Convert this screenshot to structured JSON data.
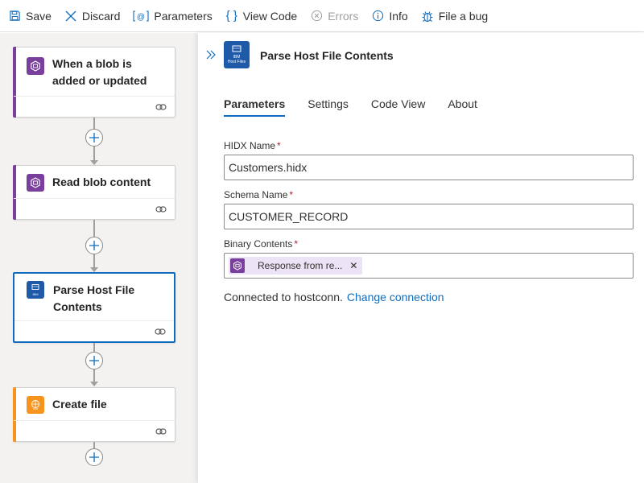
{
  "toolbar": {
    "save": "Save",
    "discard": "Discard",
    "parameters": "Parameters",
    "view_code": "View Code",
    "errors": "Errors",
    "info": "Info",
    "file_bug": "File a bug"
  },
  "canvas": {
    "cards": [
      {
        "title": "When a blob is added or updated",
        "accent": "#7a3e9d"
      },
      {
        "title": "Read blob content",
        "accent": "#7a3e9d"
      },
      {
        "title": "Parse Host File Contents",
        "accent": "#1e5aa8"
      },
      {
        "title": "Create file",
        "accent": "#f7941d"
      }
    ]
  },
  "panel": {
    "title": "Parse Host File Contents",
    "icon_caption_1": "IBM",
    "icon_caption_2": "Host Files",
    "tabs": [
      "Parameters",
      "Settings",
      "Code View",
      "About"
    ],
    "active_tab": "Parameters",
    "fields": {
      "hidx_label": "HIDX Name",
      "hidx_value": "Customers.hidx",
      "schema_label": "Schema Name",
      "schema_value": "CUSTOMER_RECORD",
      "binary_label": "Binary Contents",
      "binary_token": "Response from re...",
      "required_mark": "*"
    },
    "connection_text": "Connected to hostconn.",
    "change_connection": "Change connection"
  },
  "colors": {
    "accent_blue": "#0f6cbd",
    "blob_purple": "#7a3e9d",
    "host_blue": "#1e5aa8",
    "file_orange": "#f7941d"
  }
}
